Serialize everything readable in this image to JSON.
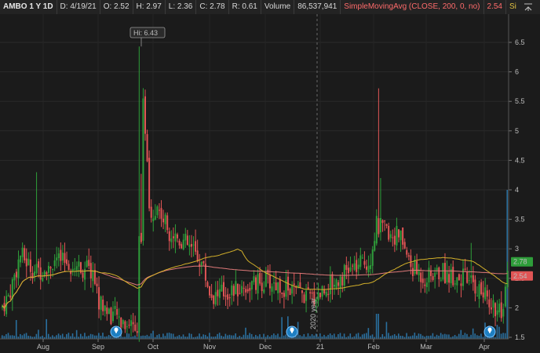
{
  "header": {
    "symbol_label": "AMBO 1 Y 1D",
    "date_label": "D: 4/19/21",
    "open_label": "O: 2.52",
    "high_label": "H: 2.97",
    "low_label": "L: 2.36",
    "close_label": "C: 2.78",
    "range_label": "R: 0.61",
    "volume_label": "Volume",
    "volume_value": "86,537,941",
    "study1_label": "SimpleMovingAvg (CLOSE, 200, 0, no)",
    "study1_value": "2.54",
    "study2_label": "SimpleMovingAvg ..."
  },
  "chart_data": {
    "type": "candlestick",
    "x_labels": [
      "Aug",
      "Sep",
      "Oct",
      "Nov",
      "Dec",
      "21",
      "Feb",
      "Mar",
      "Apr"
    ],
    "y_ticks": [
      "6.5",
      "6",
      "5.5",
      "5",
      "4.5",
      "4",
      "3.5",
      "3",
      "2.5",
      "2",
      "1.5"
    ],
    "ylim": [
      1.5,
      6.5
    ],
    "high_annotation": "Hi: 6.43",
    "year_divider_label": "2020 year",
    "price_tags": [
      {
        "value": "2.78",
        "color": "#2e9e3a"
      },
      {
        "value": "2.54",
        "color": "#e05555"
      }
    ],
    "events": [
      "Sep",
      "Dec",
      "Apr"
    ],
    "up_color": "#2e9e3a",
    "down_color": "#e05555",
    "sma_short_color": "#d4b12a",
    "sma_long_color": "#e07a7a",
    "volume_color": "#2a6f9e",
    "grid": true
  }
}
